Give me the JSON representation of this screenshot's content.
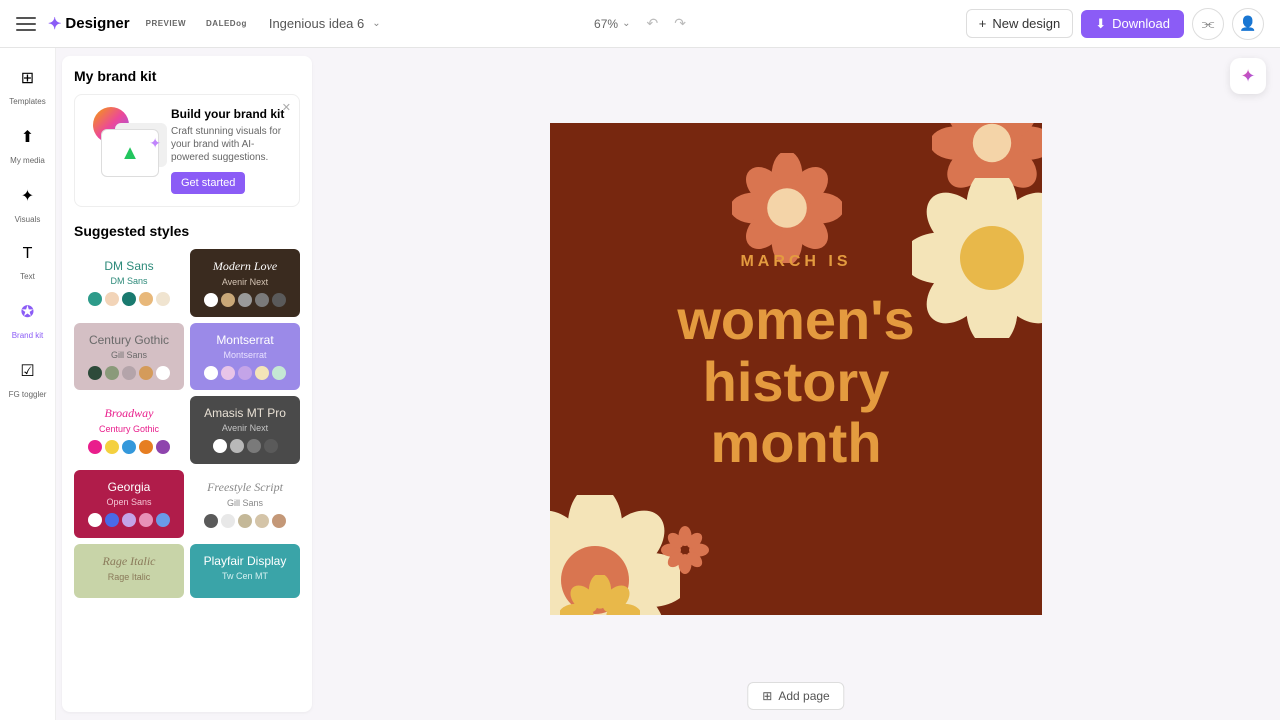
{
  "header": {
    "app_name": "Designer",
    "badge1": "PREVIEW",
    "badge2": "DALEDog",
    "doc_name": "Ingenious idea 6",
    "zoom": "67%",
    "new_design": "New design",
    "download": "Download"
  },
  "sidenav": {
    "items": [
      {
        "label": "Templates",
        "icon": "⊞"
      },
      {
        "label": "My media",
        "icon": "⬆"
      },
      {
        "label": "Visuals",
        "icon": "✦"
      },
      {
        "label": "Text",
        "icon": "T"
      },
      {
        "label": "Brand kit",
        "icon": "✪"
      },
      {
        "label": "FG toggler",
        "icon": "☑"
      }
    ]
  },
  "panel": {
    "section1_title": "My brand kit",
    "promo": {
      "title": "Build your brand kit",
      "desc": "Craft stunning visuals for your brand with AI-powered suggestions.",
      "button": "Get started"
    },
    "section2_title": "Suggested styles",
    "styles": [
      {
        "title": "DM Sans",
        "sub": "DM Sans",
        "bg": "#ffffff",
        "title_color": "#2d8a7a",
        "sub_color": "#2d8a7a",
        "swatches": [
          "#2d9b8a",
          "#f2d4b8",
          "#1a7a6f",
          "#e8b87a",
          "#f0e4d0"
        ]
      },
      {
        "title": "Modern Love",
        "sub": "Avenir Next",
        "bg": "#3a2b1f",
        "title_color": "#ffffff",
        "sub_color": "#d4c4b4",
        "title_font": "cursive",
        "swatches": [
          "#ffffff",
          "#c9a878",
          "#9a9a9a",
          "#7a7a7a",
          "#5a5a5a"
        ]
      },
      {
        "title": "Century Gothic",
        "sub": "Gill Sans",
        "bg": "#d4bfc4",
        "title_color": "#6a6a6a",
        "sub_color": "#6a6a6a",
        "swatches": [
          "#2d4a3a",
          "#8a9a7a",
          "#b4a4aa",
          "#d49b5a",
          "#ffffff"
        ]
      },
      {
        "title": "Montserrat",
        "sub": "Montserrat",
        "bg": "#9b8ae8",
        "title_color": "#ffffff",
        "sub_color": "#e8e0ff",
        "swatches": [
          "#ffffff",
          "#e8c4e8",
          "#c4a4e8",
          "#f4e4b8",
          "#c4e8d4"
        ]
      },
      {
        "title": "Broadway",
        "sub": "Century Gothic",
        "bg": "#ffffff",
        "title_color": "#e91e8c",
        "sub_color": "#e91e8c",
        "title_font": "cursive",
        "swatches": [
          "#e91e8c",
          "#f4d03f",
          "#3498db",
          "#e67e22",
          "#8e44ad"
        ]
      },
      {
        "title": "Amasis MT Pro",
        "sub": "Avenir Next",
        "bg": "#4a4a4a",
        "title_color": "#e8e0d4",
        "sub_color": "#c4c4c4",
        "swatches": [
          "#ffffff",
          "#b8b8b8",
          "#7a7a7a",
          "#5a5a5a"
        ]
      },
      {
        "title": "Georgia",
        "sub": "Open Sans",
        "bg": "#b01c4a",
        "title_color": "#ffffff",
        "sub_color": "#f4c4d4",
        "swatches": [
          "#ffffff",
          "#4a6ae8",
          "#c4a4e8",
          "#e891b8",
          "#6a9ae8"
        ]
      },
      {
        "title": "Freestyle Script",
        "sub": "Gill Sans",
        "bg": "#ffffff",
        "title_color": "#888",
        "sub_color": "#888",
        "title_font": "cursive",
        "swatches": [
          "#5a5a5a",
          "#e8e8e8",
          "#c4b898",
          "#d4c4a8",
          "#c49878"
        ]
      },
      {
        "title": "Rage Italic",
        "sub": "Rage Italic",
        "bg": "#c8d4a8",
        "title_color": "#8a7a5a",
        "sub_color": "#8a7a5a",
        "title_font": "cursive",
        "swatches": []
      },
      {
        "title": "Playfair Display",
        "sub": "Tw Cen MT",
        "bg": "#3aa4a8",
        "title_color": "#ffffff",
        "sub_color": "#d4f0f0",
        "swatches": []
      }
    ]
  },
  "canvas": {
    "subtitle": "MARCH IS",
    "title_line1": "women's",
    "title_line2": "history",
    "title_line3": "month"
  },
  "add_page": "Add page"
}
